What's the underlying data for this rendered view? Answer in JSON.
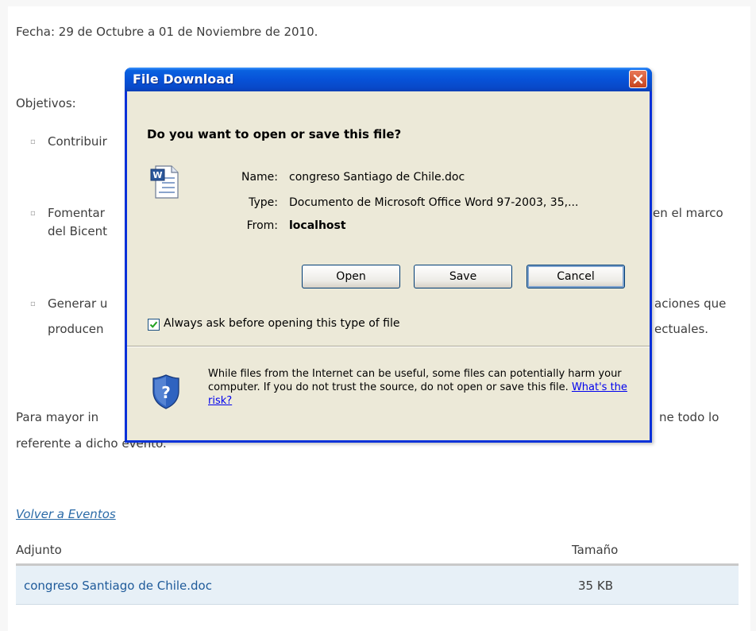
{
  "page": {
    "date_line": "Fecha: 29 de Octubre a 01 de Noviembre de 2010.",
    "objectives_heading": "Objetivos:",
    "bullets": [
      {
        "line1_left": "Contribuir",
        "line1_right": "",
        "line2_left": "",
        "line2_right": ""
      },
      {
        "line1_left": "Fomentar",
        "line1_right": "en el marco",
        "line2_left": "del Bicent",
        "line2_right": ""
      },
      {
        "line1_left": "Generar u",
        "line1_right": "aciones que",
        "line2_left": "producen",
        "line2_right": "ectuales."
      }
    ],
    "more_info_left": "Para mayor in",
    "more_info_right": "ne todo lo",
    "more_info_line2": "referente a dicho evento.",
    "back_link": "Volver a Eventos",
    "table": {
      "headers": [
        "Adjunto",
        "Tamaño"
      ],
      "rows": [
        {
          "file": "congreso Santiago de Chile.doc",
          "size": "35 KB"
        }
      ]
    }
  },
  "dialog": {
    "title": "File Download",
    "question": "Do you want to open or save this file?",
    "fields": [
      {
        "label": "Name:",
        "value": "congreso Santiago de Chile.doc"
      },
      {
        "label": "Type:",
        "value": "Documento de Microsoft Office Word 97-2003, 35,..."
      },
      {
        "label": "From:",
        "value": "localhost"
      }
    ],
    "buttons": {
      "open": "Open",
      "save": "Save",
      "cancel": "Cancel"
    },
    "checkbox": {
      "label": "Always ask before opening this type of file",
      "checked": true
    },
    "warning_text": "While files from the Internet can be useful, some files can potentially harm your computer. If you do not trust the source, do not open or save this file.",
    "risk_link": "What's the risk?",
    "icons": {
      "file": "word-document-icon",
      "security": "shield-question-icon",
      "close": "close-icon"
    },
    "colors": {
      "title_bar": "#0752d8",
      "close": "#c6431d",
      "face": "#ece9d8"
    }
  }
}
